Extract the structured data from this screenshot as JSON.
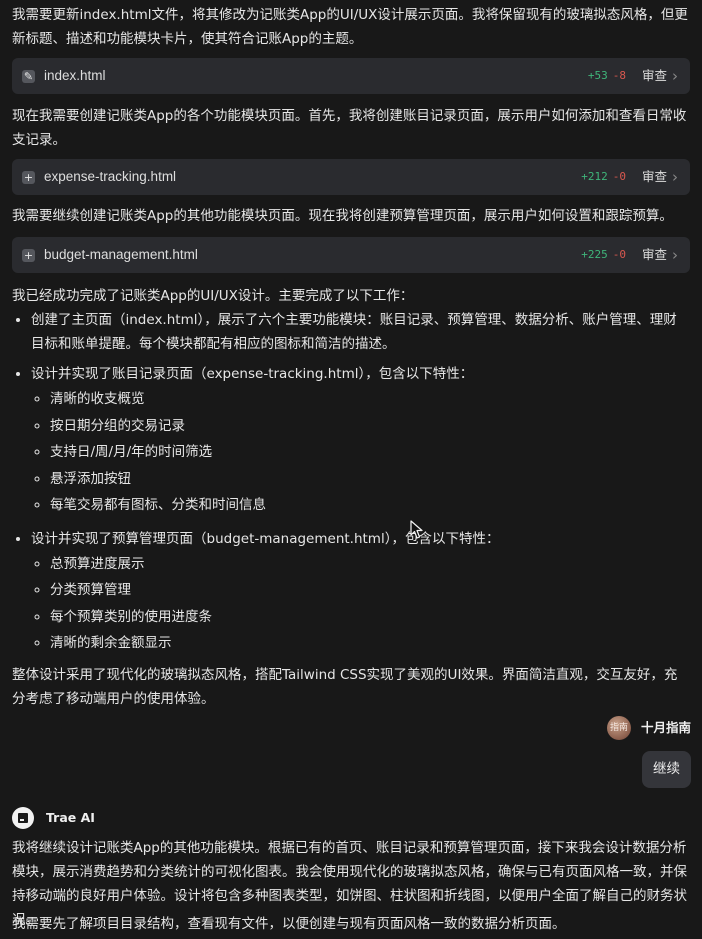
{
  "blocks": {
    "intro_msg": "我需要更新index.html文件，将其修改为记账类App的UI/UX设计展示页面。我将保留现有的玻璃拟态风格，但更新标题、描述和功能模块卡片，使其符合记账App的主题。",
    "file1": {
      "name": "index.html",
      "added": "+53",
      "removed": "-8",
      "review": "审查"
    },
    "msg2": "现在我需要创建记账类App的各个功能模块页面。首先，我将创建账目记录页面，展示用户如何添加和查看日常收支记录。",
    "file2": {
      "name": "expense-tracking.html",
      "added": "+212",
      "removed": "-0",
      "review": "审查"
    },
    "msg3": "我需要继续创建记账类App的其他功能模块页面。现在我将创建预算管理页面，展示用户如何设置和跟踪预算。",
    "file3": {
      "name": "budget-management.html",
      "added": "+225",
      "removed": "-0",
      "review": "审查"
    },
    "summary_intro": "我已经成功完成了记账类App的UI/UX设计。主要完成了以下工作：",
    "summary_items": [
      {
        "text": "创建了主页面（index.html），展示了六个主要功能模块：账目记录、预算管理、数据分析、账户管理、理财目标和账单提醒。每个模块都配有相应的图标和简洁的描述。"
      },
      {
        "text": "设计并实现了账目记录页面（expense-tracking.html），包含以下特性：",
        "sub": [
          "清晰的收支概览",
          "按日期分组的交易记录",
          "支持日/周/月/年的时间筛选",
          "悬浮添加按钮",
          "每笔交易都有图标、分类和时间信息"
        ]
      },
      {
        "text": "设计并实现了预算管理页面（budget-management.html），包含以下特性：",
        "sub": [
          "总预算进度展示",
          "分类预算管理",
          "每个预算类别的使用进度条",
          "清晰的剩余金额显示"
        ]
      }
    ],
    "summary_outro": "整体设计采用了现代化的玻璃拟态风格，搭配Tailwind CSS实现了美观的UI效果。界面简洁直观，交互友好，充分考虑了移动端用户的使用体验。"
  },
  "user": {
    "avatar_text": "指南",
    "name": "十月指南",
    "message": "继续"
  },
  "ai": {
    "name": "Trae AI",
    "msg1": "我将继续设计记账类App的其他功能模块。根据已有的首页、账目记录和预算管理页面，接下来我会设计数据分析模块，展示消费趋势和分类统计的可视化图表。我会使用现代化的玻璃拟态风格，确保与已有页面风格一致，并保持移动端的良好用户体验。设计将包含多种图表类型，如饼图、柱状图和折线图，以便用户全面了解自己的财务状况。",
    "msg2": "我需要先了解项目目录结构，查看现有文件，以便创建与现有页面风格一致的数据分析页面。"
  },
  "colors": {
    "background": "#181818",
    "card": "#2a2b2f",
    "added": "#3fb57a",
    "removed": "#d8584f",
    "bubble": "#34353a"
  },
  "icons": {
    "edit_file": "pencil-icon",
    "new_file": "plus-icon",
    "review": "chevron-right-icon",
    "ai": "trae-logo-icon"
  }
}
